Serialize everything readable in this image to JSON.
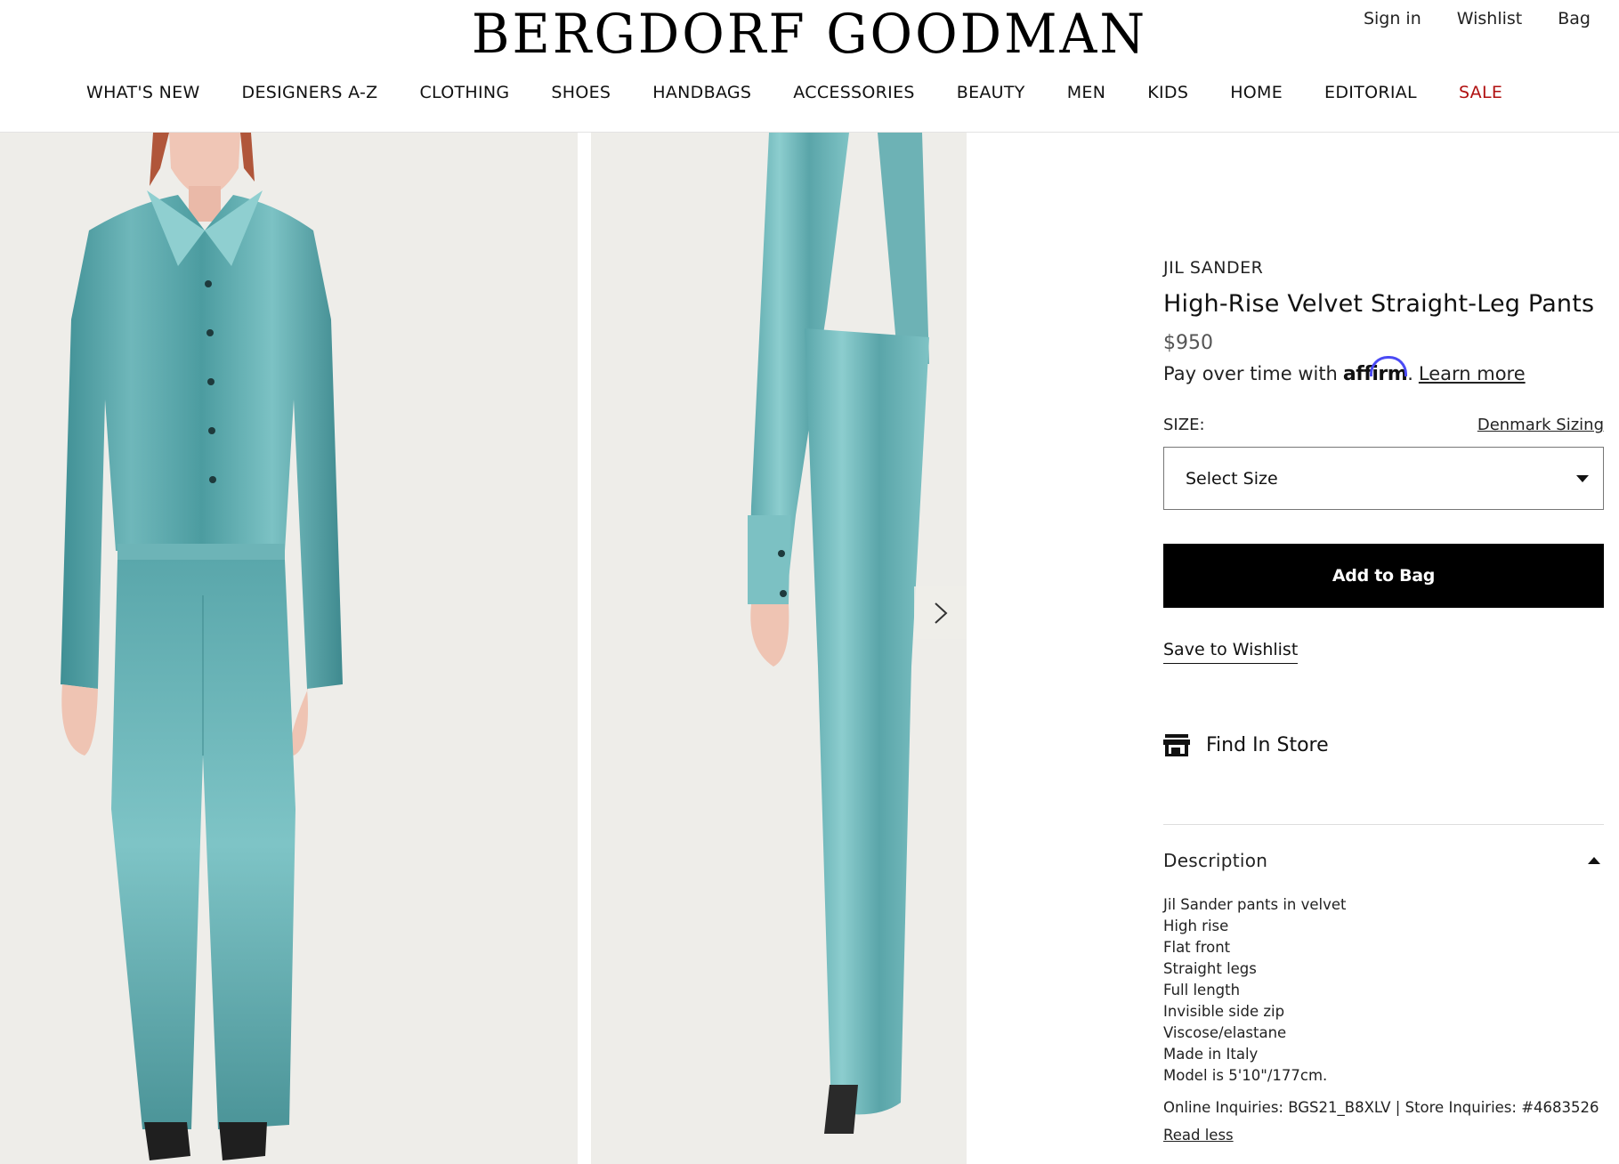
{
  "header": {
    "logo": "BERGDORF GOODMAN",
    "utility": [
      "Sign in",
      "Wishlist",
      "Bag"
    ]
  },
  "nav": [
    {
      "label": "WHAT'S NEW",
      "name": "nav-whats-new"
    },
    {
      "label": "DESIGNERS A-Z",
      "name": "nav-designers"
    },
    {
      "label": "CLOTHING",
      "name": "nav-clothing"
    },
    {
      "label": "SHOES",
      "name": "nav-shoes"
    },
    {
      "label": "HANDBAGS",
      "name": "nav-handbags"
    },
    {
      "label": "ACCESSORIES",
      "name": "nav-accessories"
    },
    {
      "label": "BEAUTY",
      "name": "nav-beauty"
    },
    {
      "label": "MEN",
      "name": "nav-men"
    },
    {
      "label": "KIDS",
      "name": "nav-kids"
    },
    {
      "label": "HOME",
      "name": "nav-home"
    },
    {
      "label": "EDITORIAL",
      "name": "nav-editorial"
    },
    {
      "label": "SALE",
      "name": "nav-sale"
    }
  ],
  "colors": {
    "sale": "#b01010",
    "velvet": "#5fa6aa",
    "image_bg": "#eeede9",
    "affirm_arc": "#4a4af4"
  },
  "product": {
    "brand": "JIL SANDER",
    "title": "High-Rise Velvet Straight-Leg Pants",
    "price": "$950",
    "affirm_prefix": "Pay over time with",
    "affirm_logo": "affirm",
    "affirm_dot": ".",
    "learn_more": "Learn more",
    "size_label": "SIZE:",
    "sizing_link": "Denmark Sizing",
    "select_placeholder": "Select Size",
    "add_to_bag": "Add to Bag",
    "save_wishlist": "Save to Wishlist",
    "find_in_store": "Find In Store",
    "description_heading": "Description",
    "description": [
      "Jil Sander pants in velvet",
      "High rise",
      "Flat front",
      "Straight legs",
      "Full length",
      "Invisible side zip",
      "Viscose/elastane",
      "Made in Italy",
      "Model is 5'10\"/177cm."
    ],
    "inquiries": "Online Inquiries: BGS21_B8XLV | Store Inquiries: #4683526",
    "read_less": "Read less"
  },
  "icons": {
    "next": "chevron-right-icon",
    "store": "store-icon",
    "size_dropdown": "caret-down-icon",
    "desc_toggle": "caret-up-icon"
  }
}
